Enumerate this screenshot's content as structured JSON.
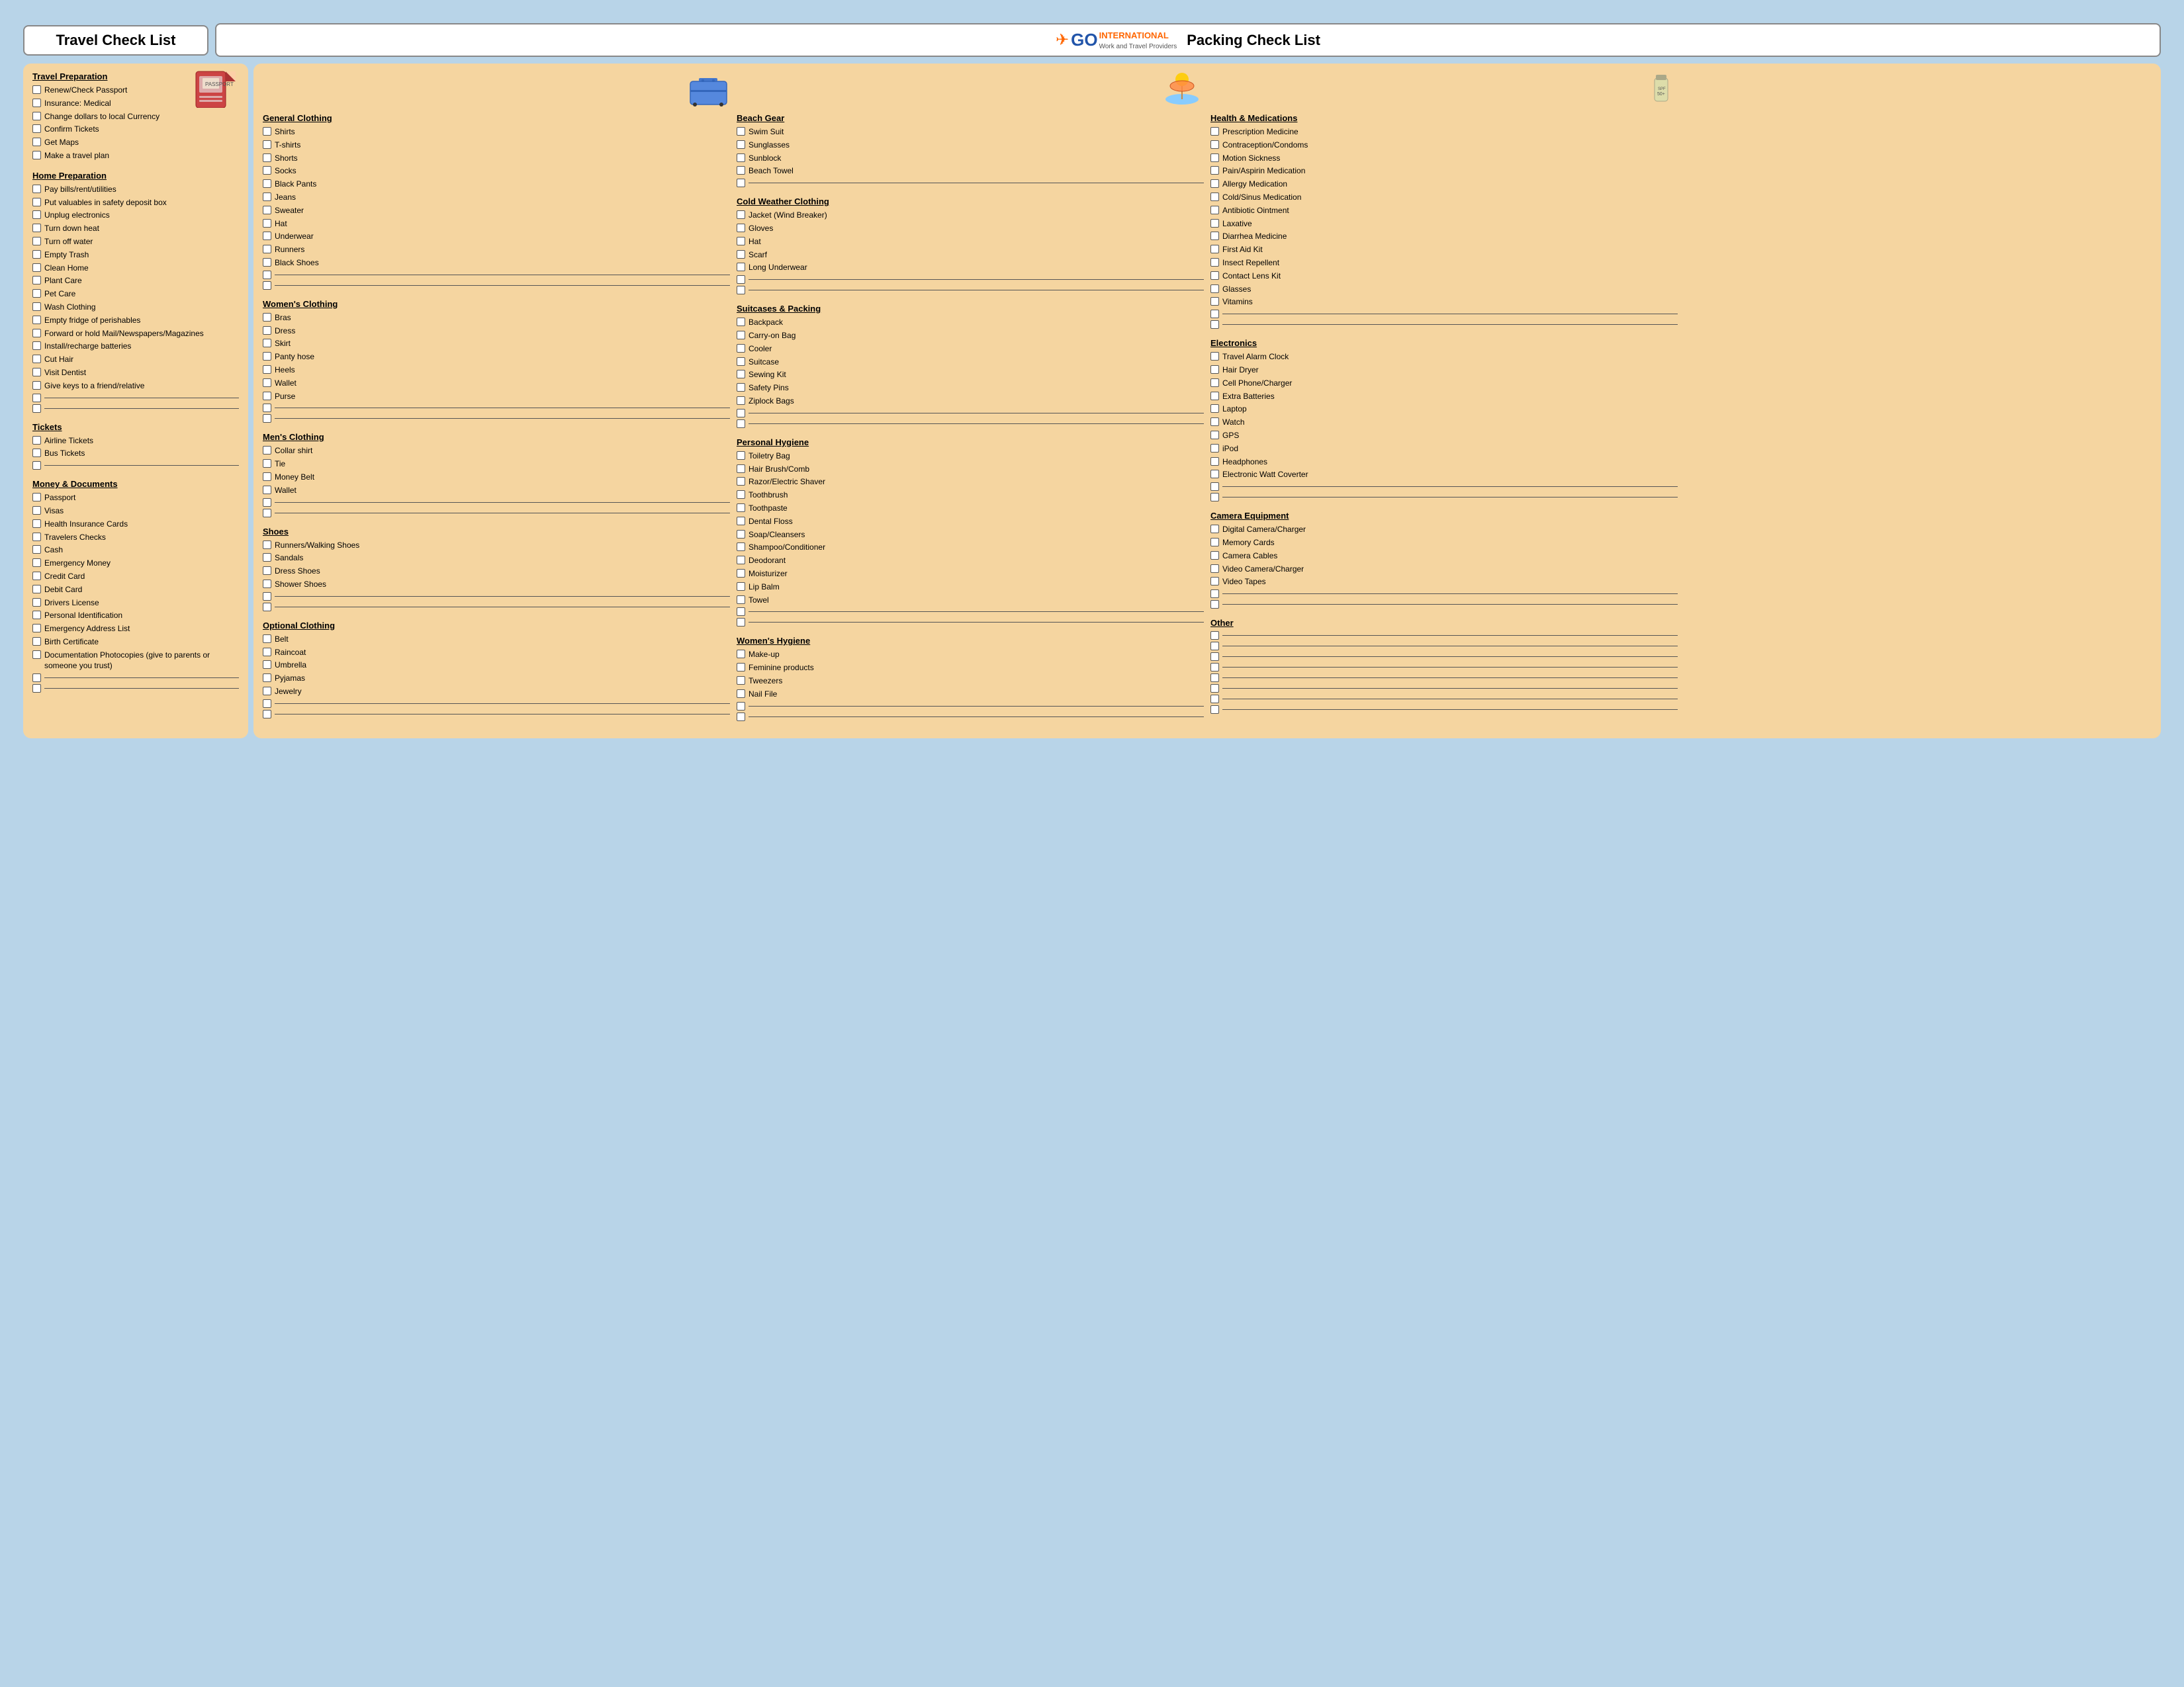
{
  "header": {
    "travel_title": "Travel Check List",
    "packing_title": "Packing Check List",
    "logo_go": "GO",
    "logo_international": "INTERNATIONAL",
    "logo_subtitle": "Work and Travel Providers"
  },
  "left": {
    "sections": [
      {
        "id": "travel-prep",
        "title": "Travel Preparation",
        "items": [
          "Renew/Check Passport",
          "Insurance: Medical",
          "Change dollars to local Currency",
          "Confirm Tickets",
          "Get Maps",
          "Make a travel plan"
        ],
        "blanks": 0
      },
      {
        "id": "home-prep",
        "title": "Home Preparation",
        "items": [
          "Pay bills/rent/utilities",
          "Put valuables in safety deposit box",
          "Unplug electronics",
          "Turn down heat",
          "Turn off water",
          "Empty Trash",
          "Clean Home",
          "Plant Care",
          "Pet Care",
          "Wash Clothing",
          "Empty fridge of perishables",
          "Forward or hold Mail/Newspapers/Magazines",
          "Install/recharge batteries",
          "Cut Hair",
          "Visit Dentist",
          "Give keys to a friend/relative"
        ],
        "blanks": 2
      },
      {
        "id": "tickets",
        "title": "Tickets",
        "items": [
          "Airline Tickets",
          "Bus Tickets"
        ],
        "blanks": 1
      },
      {
        "id": "money-docs",
        "title": "Money & Documents",
        "items": [
          "Passport",
          "Visas",
          "Health Insurance Cards",
          "Travelers Checks",
          "Cash",
          "Emergency Money",
          "Credit Card",
          "Debit Card",
          "Drivers License",
          "Personal Identification",
          "Emergency Address List",
          "Birth Certificate",
          "Documentation Photocopies (give to parents or someone you trust)"
        ],
        "blanks": 2
      }
    ]
  },
  "right": {
    "col1": [
      {
        "id": "general-clothing",
        "title": "General Clothing",
        "items": [
          "Shirts",
          "T-shirts",
          "Shorts",
          "Socks",
          "Black Pants",
          "Jeans",
          "Sweater",
          "Hat",
          "Underwear",
          "Runners",
          "Black Shoes"
        ],
        "blanks": 2
      },
      {
        "id": "womens-clothing",
        "title": "Women's Clothing",
        "items": [
          "Bras",
          "Dress",
          "Skirt",
          "Panty hose",
          "Heels",
          "Wallet",
          "Purse"
        ],
        "blanks": 2
      },
      {
        "id": "mens-clothing",
        "title": "Men's Clothing",
        "items": [
          "Collar shirt",
          "Tie",
          "Money Belt",
          "Wallet"
        ],
        "blanks": 2
      },
      {
        "id": "shoes",
        "title": "Shoes",
        "items": [
          "Runners/Walking Shoes",
          "Sandals",
          "Dress Shoes",
          "Shower Shoes"
        ],
        "blanks": 2
      },
      {
        "id": "optional-clothing",
        "title": "Optional Clothing",
        "items": [
          "Belt",
          "Raincoat",
          "Umbrella",
          "Pyjamas",
          "Jewelry"
        ],
        "blanks": 2
      }
    ],
    "col2": [
      {
        "id": "beach-gear",
        "title": "Beach Gear",
        "items": [
          "Swim Suit",
          "Sunglasses",
          "Sunblock",
          "Beach Towel"
        ],
        "blanks": 1
      },
      {
        "id": "cold-weather",
        "title": "Cold Weather Clothing",
        "items": [
          "Jacket (Wind Breaker)",
          "Gloves",
          "Hat",
          "Scarf",
          "Long Underwear"
        ],
        "blanks": 2
      },
      {
        "id": "suitcases",
        "title": "Suitcases & Packing",
        "items": [
          "Backpack",
          "Carry-on Bag",
          "Cooler",
          "Suitcase",
          "Sewing Kit",
          "Safety Pins",
          "Ziplock Bags"
        ],
        "blanks": 2
      },
      {
        "id": "personal-hygiene",
        "title": "Personal Hygiene",
        "items": [
          "Toiletry Bag",
          "Hair Brush/Comb",
          "Razor/Electric Shaver",
          "Toothbrush",
          "Toothpaste",
          "Dental Floss",
          "Soap/Cleansers",
          "Shampoo/Conditioner",
          "Deodorant",
          "Moisturizer",
          "Lip Balm",
          "Towel"
        ],
        "blanks": 2
      },
      {
        "id": "womens-hygiene",
        "title": "Women's Hygiene",
        "items": [
          "Make-up",
          "Feminine products",
          "Tweezers",
          "Nail File"
        ],
        "blanks": 2
      }
    ],
    "col3": [
      {
        "id": "health-medications",
        "title": "Health & Medications",
        "items": [
          "Prescription Medicine",
          "Contraception/Condoms",
          "Motion Sickness",
          "Pain/Aspirin Medication",
          "Allergy Medication",
          "Cold/Sinus Medication",
          "Antibiotic Ointment",
          "Laxative",
          "Diarrhea Medicine",
          "First Aid Kit",
          "Insect Repellent",
          "Contact Lens Kit",
          "Glasses",
          "Vitamins"
        ],
        "blanks": 2
      },
      {
        "id": "electronics",
        "title": "Electronics",
        "items": [
          "Travel Alarm Clock",
          "Hair Dryer",
          "Cell Phone/Charger",
          "Extra Batteries",
          "Laptop",
          "Watch",
          "GPS",
          "iPod",
          "Headphones",
          "Electronic Watt Coverter"
        ],
        "blanks": 2
      },
      {
        "id": "camera",
        "title": "Camera Equipment",
        "items": [
          "Digital Camera/Charger",
          "Memory Cards",
          "Camera Cables",
          "Video Camera/Charger",
          "Video Tapes"
        ],
        "blanks": 2
      },
      {
        "id": "other",
        "title": "Other",
        "items": [],
        "blanks": 8
      }
    ]
  }
}
